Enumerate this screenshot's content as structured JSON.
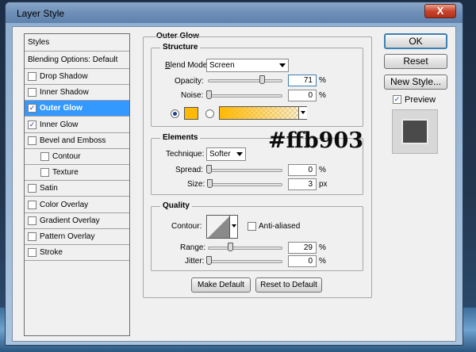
{
  "window": {
    "title": "Layer Style",
    "close_glyph": "X"
  },
  "styles_panel": {
    "header": "Styles",
    "blending_options": "Blending Options: Default",
    "items": [
      {
        "label": "Drop Shadow",
        "checked": false,
        "indent": false
      },
      {
        "label": "Inner Shadow",
        "checked": false,
        "indent": false
      },
      {
        "label": "Outer Glow",
        "checked": true,
        "indent": false,
        "selected": true
      },
      {
        "label": "Inner Glow",
        "checked": true,
        "indent": false
      },
      {
        "label": "Bevel and Emboss",
        "checked": false,
        "indent": false
      },
      {
        "label": "Contour",
        "checked": false,
        "indent": true
      },
      {
        "label": "Texture",
        "checked": false,
        "indent": true
      },
      {
        "label": "Satin",
        "checked": false,
        "indent": false
      },
      {
        "label": "Color Overlay",
        "checked": false,
        "indent": false
      },
      {
        "label": "Gradient Overlay",
        "checked": false,
        "indent": false
      },
      {
        "label": "Pattern Overlay",
        "checked": false,
        "indent": false
      },
      {
        "label": "Stroke",
        "checked": false,
        "indent": false
      }
    ],
    "check_glyph": "✓"
  },
  "outer_glow": {
    "title": "Outer Glow",
    "structure": {
      "title": "Structure",
      "blend_mode_label": "Blend Mode:",
      "blend_mode_value": "Screen",
      "opacity_label": "Opacity:",
      "opacity_value": "71",
      "opacity_level": 0.71,
      "noise_label": "Noise:",
      "noise_value": "0",
      "noise_level": 0,
      "unit": "%",
      "color_swatch": "#ffb903",
      "gradient_from": "#ffb903",
      "color_mode": "solid"
    },
    "elements": {
      "title": "Elements",
      "technique_label": "Technique:",
      "technique_value": "Softer",
      "spread_label": "Spread:",
      "spread_value": "0",
      "spread_level": 0,
      "spread_unit": "%",
      "size_label": "Size:",
      "size_value": "3",
      "size_level": 0.012,
      "size_unit": "px"
    },
    "quality": {
      "title": "Quality",
      "contour_label": "Contour:",
      "anti_aliased_label": "Anti-aliased",
      "anti_aliased": false,
      "range_label": "Range:",
      "range_value": "29",
      "range_level": 0.29,
      "range_unit": "%",
      "jitter_label": "Jitter:",
      "jitter_value": "0",
      "jitter_level": 0,
      "jitter_unit": "%"
    },
    "make_default_label": "Make Default",
    "reset_default_label": "Reset to Default"
  },
  "actions": {
    "ok_label": "OK",
    "reset_label": "Reset",
    "new_style_label": "New Style...",
    "preview_label": "Preview",
    "preview_checked": true
  },
  "annotation": {
    "text": "#ffb903"
  }
}
